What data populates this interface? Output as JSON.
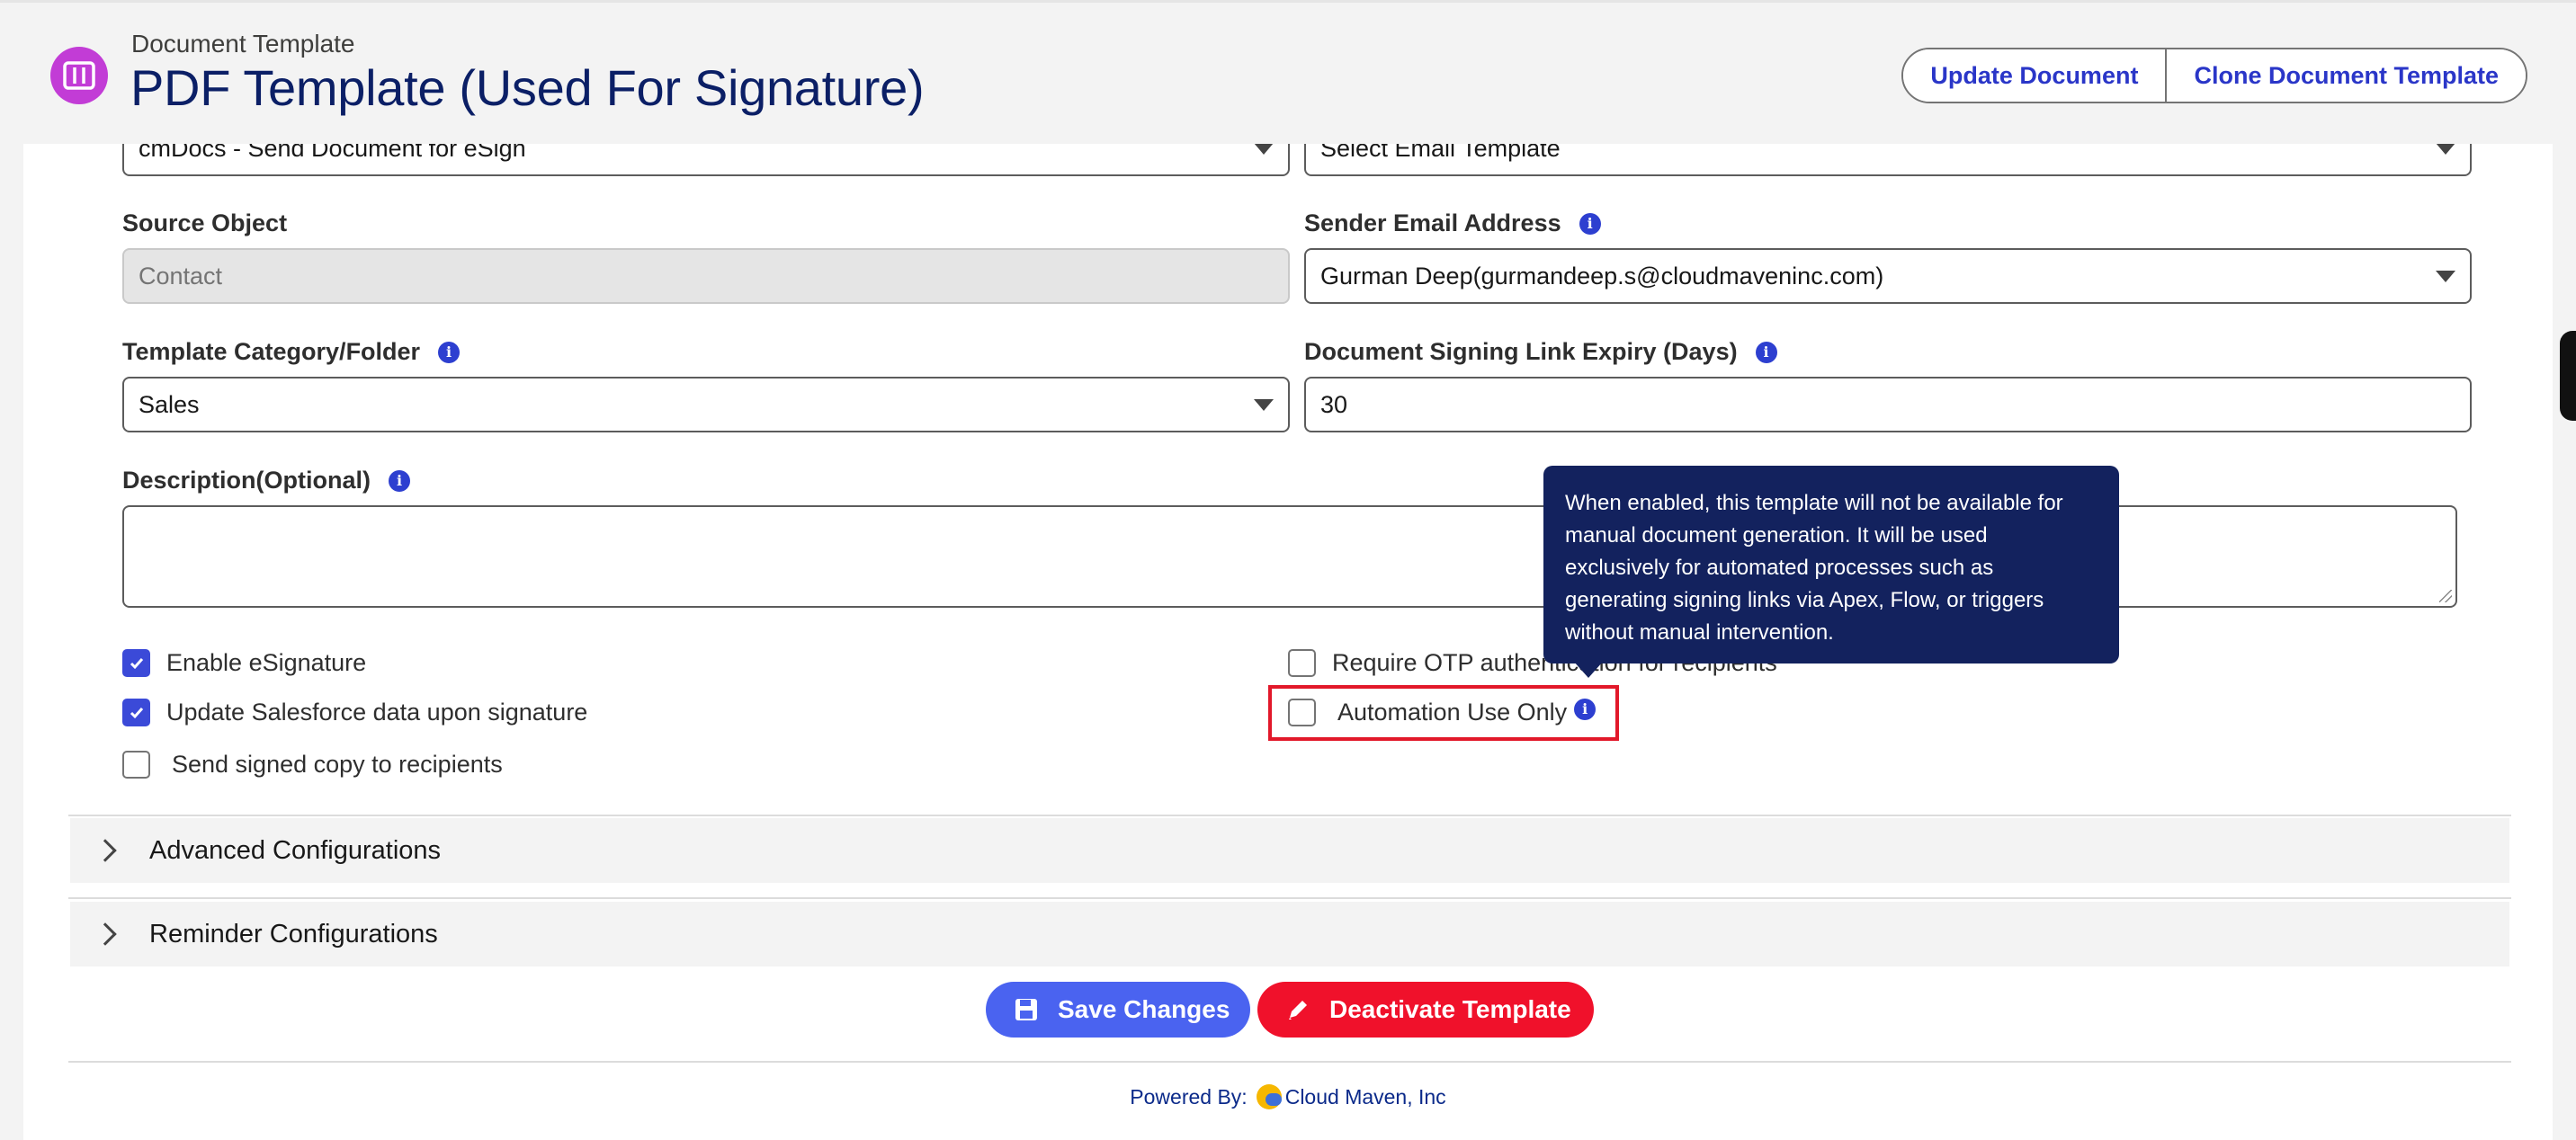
{
  "header": {
    "subtitle": "Document Template",
    "title": "PDF Template (Used For Signature)",
    "update_button": "Update Document",
    "clone_button": "Clone Document Template"
  },
  "form": {
    "partial_top_left_value": "cmDocs - Send Document for eSign",
    "partial_top_right_value": "Select Email Template",
    "source_object": {
      "label": "Source Object",
      "value": "Contact"
    },
    "sender_email": {
      "label": "Sender Email Address",
      "value": "Gurman Deep(gurmandeep.s@cloudmaveninc.com)"
    },
    "category": {
      "label": "Template Category/Folder",
      "value": "Sales"
    },
    "expiry": {
      "label": "Document Signing Link Expiry (Days)",
      "value": "30"
    },
    "description": {
      "label": "Description(Optional)",
      "value": ""
    }
  },
  "checkboxes": {
    "enable_esignature": {
      "label": "Enable eSignature",
      "checked": true
    },
    "update_salesforce": {
      "label": "Update Salesforce data upon signature",
      "checked": true
    },
    "send_signed_copy": {
      "label": "Send signed copy to recipients",
      "checked": false
    },
    "require_otp": {
      "label": "Require OTP authentication for recipients",
      "checked": false
    },
    "automation_only": {
      "label": "Automation Use Only",
      "checked": false
    }
  },
  "tooltip": {
    "line1": "When enabled, this template will not be available for",
    "line2": "manual document generation. It will be used",
    "line3": "exclusively for automated processes such as",
    "line4": "generating signing links via Apex, Flow, or triggers",
    "line5": "without manual intervention."
  },
  "accordions": {
    "advanced": "Advanced Configurations",
    "reminder": "Reminder Configurations"
  },
  "actions": {
    "save": "Save Changes",
    "deactivate": "Deactivate Template"
  },
  "footer": {
    "prefix": "Powered By:",
    "company": "Cloud Maven, Inc"
  },
  "colors": {
    "accent_blue": "#3b4ad8",
    "save_blue": "#4a63f0",
    "deactivate_red": "#f0112b",
    "tooltip_navy": "#13225e",
    "highlight_red": "#e2182a",
    "icon_purple": "#c23cd6"
  }
}
